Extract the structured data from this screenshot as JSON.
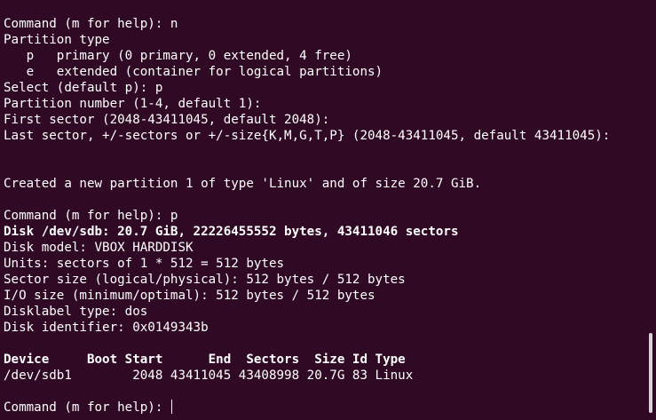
{
  "terminal": {
    "lines": [
      {
        "text": "Command (m for help): n",
        "bold": false
      },
      {
        "text": "Partition type",
        "bold": false
      },
      {
        "text": "   p   primary (0 primary, 0 extended, 4 free)",
        "bold": false
      },
      {
        "text": "   e   extended (container for logical partitions)",
        "bold": false
      },
      {
        "text": "Select (default p): p",
        "bold": false
      },
      {
        "text": "Partition number (1-4, default 1):",
        "bold": false
      },
      {
        "text": "First sector (2048-43411045, default 2048):",
        "bold": false
      },
      {
        "text": "Last sector, +/-sectors or +/-size{K,M,G,T,P} (2048-43411045, default 43411045):",
        "bold": false
      },
      {
        "text": "",
        "bold": false
      },
      {
        "text": "",
        "bold": false
      },
      {
        "text": "Created a new partition 1 of type 'Linux' and of size 20.7 GiB.",
        "bold": false
      },
      {
        "text": "",
        "bold": false
      },
      {
        "text": "Command (m for help): p",
        "bold": false
      },
      {
        "text": "Disk /dev/sdb: 20.7 GiB, 22226455552 bytes, 43411046 sectors",
        "bold": true
      },
      {
        "text": "Disk model: VBOX HARDDISK",
        "bold": false
      },
      {
        "text": "Units: sectors of 1 * 512 = 512 bytes",
        "bold": false
      },
      {
        "text": "Sector size (logical/physical): 512 bytes / 512 bytes",
        "bold": false
      },
      {
        "text": "I/O size (minimum/optimal): 512 bytes / 512 bytes",
        "bold": false
      },
      {
        "text": "Disklabel type: dos",
        "bold": false
      },
      {
        "text": "Disk identifier: 0x0149343b",
        "bold": false
      },
      {
        "text": "",
        "bold": false
      },
      {
        "text": "Device     Boot Start      End  Sectors  Size Id Type",
        "bold": true
      },
      {
        "text": "/dev/sdb1        2048 43411045 43408998 20.7G 83 Linux",
        "bold": false
      },
      {
        "text": "",
        "bold": false
      }
    ],
    "prompt": "Command (m for help): "
  },
  "colors": {
    "background": "#300a24",
    "foreground": "#ffffff",
    "scrollbar": "#d9d2d6"
  }
}
